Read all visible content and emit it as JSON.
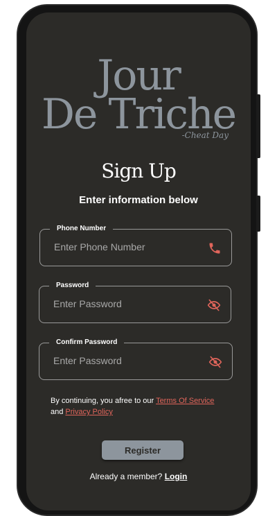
{
  "brand": {
    "line1": "Jour",
    "line2": "De Triche",
    "tagline": "-Cheat Day"
  },
  "form": {
    "title": "Sign Up",
    "subtitle": "Enter information below",
    "phone": {
      "label": "Phone Number",
      "placeholder": "Enter Phone Number",
      "icon": "phone-icon"
    },
    "password": {
      "label": "Password",
      "placeholder": "Enter Password",
      "icon": "eye-off-icon"
    },
    "confirm": {
      "label": "Confirm Password",
      "placeholder": "Enter Password",
      "icon": "eye-off-icon"
    },
    "terms_prefix": "By continuing, you afree to our ",
    "terms_link": "Terms Of Service",
    "terms_and": "and ",
    "privacy_link": "Privacy Policy",
    "register_label": "Register",
    "already_text": "Already a member? ",
    "login_label": "Login"
  },
  "colors": {
    "background": "#2c2b28",
    "logo": "#8d959d",
    "accent": "#e0655b",
    "button": "#8d959d"
  }
}
